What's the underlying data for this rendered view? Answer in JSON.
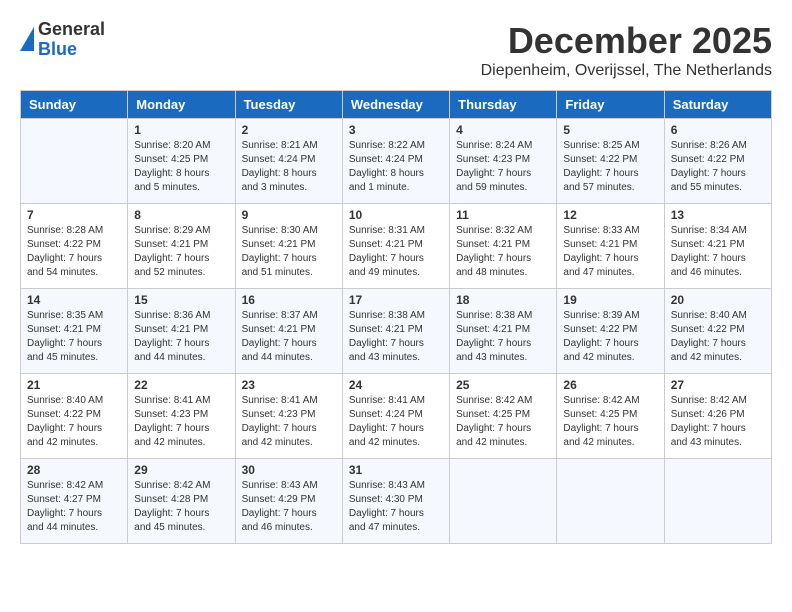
{
  "header": {
    "logo_general": "General",
    "logo_blue": "Blue",
    "month": "December 2025",
    "location": "Diepenheim, Overijssel, The Netherlands"
  },
  "days_of_week": [
    "Sunday",
    "Monday",
    "Tuesday",
    "Wednesday",
    "Thursday",
    "Friday",
    "Saturday"
  ],
  "weeks": [
    [
      {
        "day": "",
        "sunrise": "",
        "sunset": "",
        "daylight": ""
      },
      {
        "day": "1",
        "sunrise": "Sunrise: 8:20 AM",
        "sunset": "Sunset: 4:25 PM",
        "daylight": "Daylight: 8 hours and 5 minutes."
      },
      {
        "day": "2",
        "sunrise": "Sunrise: 8:21 AM",
        "sunset": "Sunset: 4:24 PM",
        "daylight": "Daylight: 8 hours and 3 minutes."
      },
      {
        "day": "3",
        "sunrise": "Sunrise: 8:22 AM",
        "sunset": "Sunset: 4:24 PM",
        "daylight": "Daylight: 8 hours and 1 minute."
      },
      {
        "day": "4",
        "sunrise": "Sunrise: 8:24 AM",
        "sunset": "Sunset: 4:23 PM",
        "daylight": "Daylight: 7 hours and 59 minutes."
      },
      {
        "day": "5",
        "sunrise": "Sunrise: 8:25 AM",
        "sunset": "Sunset: 4:22 PM",
        "daylight": "Daylight: 7 hours and 57 minutes."
      },
      {
        "day": "6",
        "sunrise": "Sunrise: 8:26 AM",
        "sunset": "Sunset: 4:22 PM",
        "daylight": "Daylight: 7 hours and 55 minutes."
      }
    ],
    [
      {
        "day": "7",
        "sunrise": "Sunrise: 8:28 AM",
        "sunset": "Sunset: 4:22 PM",
        "daylight": "Daylight: 7 hours and 54 minutes."
      },
      {
        "day": "8",
        "sunrise": "Sunrise: 8:29 AM",
        "sunset": "Sunset: 4:21 PM",
        "daylight": "Daylight: 7 hours and 52 minutes."
      },
      {
        "day": "9",
        "sunrise": "Sunrise: 8:30 AM",
        "sunset": "Sunset: 4:21 PM",
        "daylight": "Daylight: 7 hours and 51 minutes."
      },
      {
        "day": "10",
        "sunrise": "Sunrise: 8:31 AM",
        "sunset": "Sunset: 4:21 PM",
        "daylight": "Daylight: 7 hours and 49 minutes."
      },
      {
        "day": "11",
        "sunrise": "Sunrise: 8:32 AM",
        "sunset": "Sunset: 4:21 PM",
        "daylight": "Daylight: 7 hours and 48 minutes."
      },
      {
        "day": "12",
        "sunrise": "Sunrise: 8:33 AM",
        "sunset": "Sunset: 4:21 PM",
        "daylight": "Daylight: 7 hours and 47 minutes."
      },
      {
        "day": "13",
        "sunrise": "Sunrise: 8:34 AM",
        "sunset": "Sunset: 4:21 PM",
        "daylight": "Daylight: 7 hours and 46 minutes."
      }
    ],
    [
      {
        "day": "14",
        "sunrise": "Sunrise: 8:35 AM",
        "sunset": "Sunset: 4:21 PM",
        "daylight": "Daylight: 7 hours and 45 minutes."
      },
      {
        "day": "15",
        "sunrise": "Sunrise: 8:36 AM",
        "sunset": "Sunset: 4:21 PM",
        "daylight": "Daylight: 7 hours and 44 minutes."
      },
      {
        "day": "16",
        "sunrise": "Sunrise: 8:37 AM",
        "sunset": "Sunset: 4:21 PM",
        "daylight": "Daylight: 7 hours and 44 minutes."
      },
      {
        "day": "17",
        "sunrise": "Sunrise: 8:38 AM",
        "sunset": "Sunset: 4:21 PM",
        "daylight": "Daylight: 7 hours and 43 minutes."
      },
      {
        "day": "18",
        "sunrise": "Sunrise: 8:38 AM",
        "sunset": "Sunset: 4:21 PM",
        "daylight": "Daylight: 7 hours and 43 minutes."
      },
      {
        "day": "19",
        "sunrise": "Sunrise: 8:39 AM",
        "sunset": "Sunset: 4:22 PM",
        "daylight": "Daylight: 7 hours and 42 minutes."
      },
      {
        "day": "20",
        "sunrise": "Sunrise: 8:40 AM",
        "sunset": "Sunset: 4:22 PM",
        "daylight": "Daylight: 7 hours and 42 minutes."
      }
    ],
    [
      {
        "day": "21",
        "sunrise": "Sunrise: 8:40 AM",
        "sunset": "Sunset: 4:22 PM",
        "daylight": "Daylight: 7 hours and 42 minutes."
      },
      {
        "day": "22",
        "sunrise": "Sunrise: 8:41 AM",
        "sunset": "Sunset: 4:23 PM",
        "daylight": "Daylight: 7 hours and 42 minutes."
      },
      {
        "day": "23",
        "sunrise": "Sunrise: 8:41 AM",
        "sunset": "Sunset: 4:23 PM",
        "daylight": "Daylight: 7 hours and 42 minutes."
      },
      {
        "day": "24",
        "sunrise": "Sunrise: 8:41 AM",
        "sunset": "Sunset: 4:24 PM",
        "daylight": "Daylight: 7 hours and 42 minutes."
      },
      {
        "day": "25",
        "sunrise": "Sunrise: 8:42 AM",
        "sunset": "Sunset: 4:25 PM",
        "daylight": "Daylight: 7 hours and 42 minutes."
      },
      {
        "day": "26",
        "sunrise": "Sunrise: 8:42 AM",
        "sunset": "Sunset: 4:25 PM",
        "daylight": "Daylight: 7 hours and 42 minutes."
      },
      {
        "day": "27",
        "sunrise": "Sunrise: 8:42 AM",
        "sunset": "Sunset: 4:26 PM",
        "daylight": "Daylight: 7 hours and 43 minutes."
      }
    ],
    [
      {
        "day": "28",
        "sunrise": "Sunrise: 8:42 AM",
        "sunset": "Sunset: 4:27 PM",
        "daylight": "Daylight: 7 hours and 44 minutes."
      },
      {
        "day": "29",
        "sunrise": "Sunrise: 8:42 AM",
        "sunset": "Sunset: 4:28 PM",
        "daylight": "Daylight: 7 hours and 45 minutes."
      },
      {
        "day": "30",
        "sunrise": "Sunrise: 8:43 AM",
        "sunset": "Sunset: 4:29 PM",
        "daylight": "Daylight: 7 hours and 46 minutes."
      },
      {
        "day": "31",
        "sunrise": "Sunrise: 8:43 AM",
        "sunset": "Sunset: 4:30 PM",
        "daylight": "Daylight: 7 hours and 47 minutes."
      },
      {
        "day": "",
        "sunrise": "",
        "sunset": "",
        "daylight": ""
      },
      {
        "day": "",
        "sunrise": "",
        "sunset": "",
        "daylight": ""
      },
      {
        "day": "",
        "sunrise": "",
        "sunset": "",
        "daylight": ""
      }
    ]
  ]
}
